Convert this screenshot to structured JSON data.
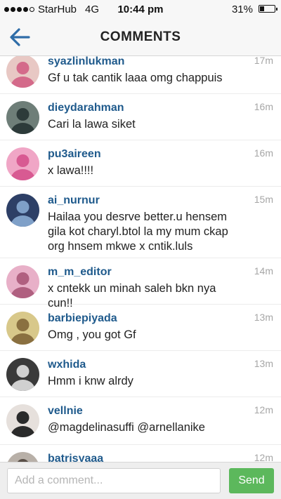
{
  "status_bar": {
    "carrier": "StarHub",
    "network": "4G",
    "time": "10:44 pm",
    "battery": "31%",
    "battery_level": 0.31,
    "signal_bars": 4,
    "signal_total": 5
  },
  "header": {
    "title": "COMMENTS",
    "back_icon": "arrow-left-icon",
    "accent_color": "#2f6da8"
  },
  "comments": [
    {
      "username": "syazlinlukman",
      "text": "Gf u tak cantik laaa omg chappuis",
      "time": "17m",
      "avatar_colors": [
        "#e8c8c4",
        "#d46a8a"
      ]
    },
    {
      "username": "dieydarahman",
      "text": "Cari la lawa siket",
      "time": "16m",
      "avatar_colors": [
        "#6e7e78",
        "#2d3b3a"
      ]
    },
    {
      "username": "pu3aireen",
      "text": "x lawa!!!!",
      "time": "16m",
      "avatar_colors": [
        "#f0a6c6",
        "#d85a92"
      ]
    },
    {
      "username": "ai_nurnur",
      "text": "Hailaa you desrve better.u hensem gila kot charyl.btol la my mum ckap org hnsem mkwe x cntik.luls",
      "time": "15m",
      "avatar_colors": [
        "#2d3f66",
        "#7fa0c8"
      ]
    },
    {
      "username": "m_m_editor",
      "text": "x cntekk un minah saleh bkn nya cun!!",
      "time": "14m",
      "avatar_colors": [
        "#e8b0c8",
        "#b06080"
      ]
    },
    {
      "username": "barbiepiyada",
      "text": "Omg , you got Gf",
      "time": "13m",
      "avatar_colors": [
        "#d8c88a",
        "#8a7040"
      ]
    },
    {
      "username": "wxhida",
      "text": "Hmm i knw alrdy",
      "time": "13m",
      "avatar_colors": [
        "#3a3a3a",
        "#d0d0d0"
      ]
    },
    {
      "username": "vellnie",
      "text": "@magdelinasuffi @arnellanike",
      "time": "12m",
      "avatar_colors": [
        "#e6e0dc",
        "#2a2a2a"
      ]
    },
    {
      "username": "batrisyaaa",
      "text": "",
      "time": "12m",
      "avatar_colors": [
        "#b8b0a8",
        "#5a5048"
      ]
    }
  ],
  "footer": {
    "placeholder": "Add a comment...",
    "send_label": "Send",
    "send_color": "#5cb85c"
  }
}
